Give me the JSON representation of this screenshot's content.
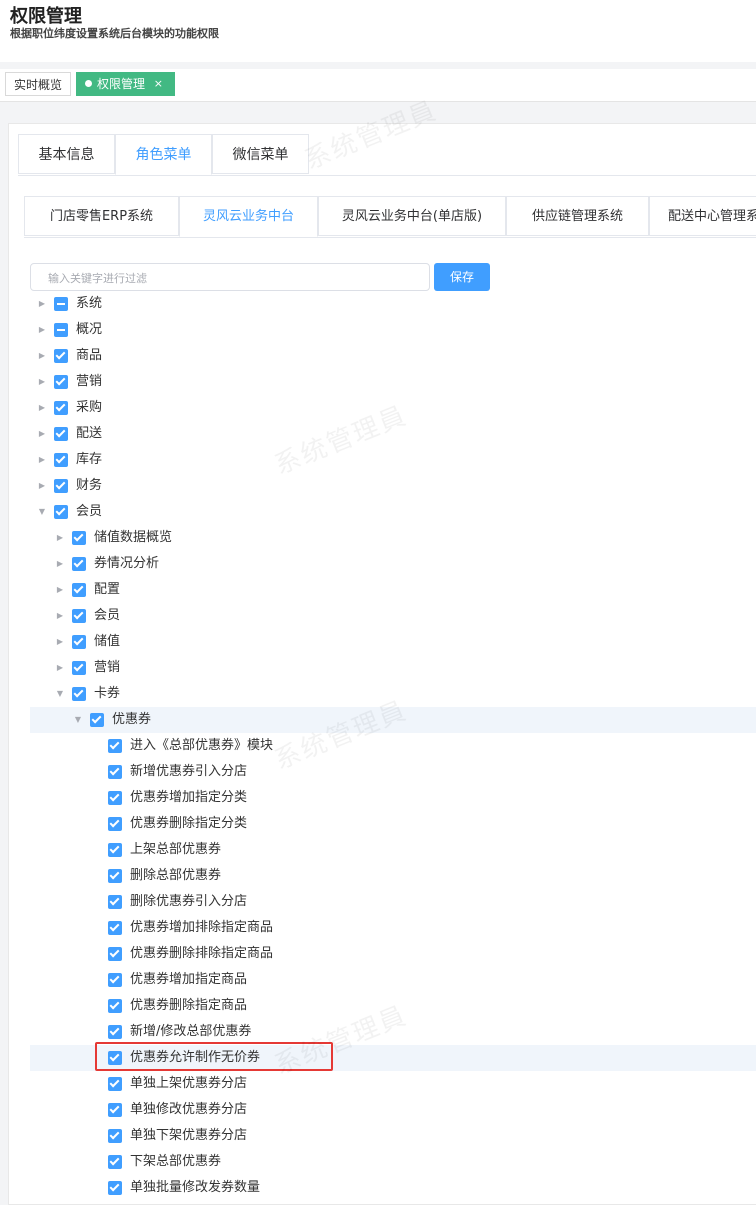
{
  "header": {
    "title": "权限管理",
    "subtitle": "根据职位纬度设置系统后台模块的功能权限"
  },
  "page_tabs": [
    {
      "label": "实时概览"
    },
    {
      "label": "权限管理",
      "close": "×"
    }
  ],
  "tabs_level1": [
    "基本信息",
    "角色菜单",
    "微信菜单"
  ],
  "tabs_level1_active": 1,
  "tabs_level2": [
    "门店零售ERP系统",
    "灵风云业务中台",
    "灵风云业务中台(单店版)",
    "供应链管理系统",
    "配送中心管理系统"
  ],
  "tabs_level2_active": 1,
  "search": {
    "placeholder": "输入关键字进行过滤"
  },
  "save_label": "保存",
  "watermark": "系统管理員",
  "tree": [
    {
      "label": "系统",
      "state": "indeterminate",
      "level": 0,
      "arrow": "right"
    },
    {
      "label": "概况",
      "state": "indeterminate",
      "level": 0,
      "arrow": "right"
    },
    {
      "label": "商品",
      "state": "checked",
      "level": 0,
      "arrow": "right"
    },
    {
      "label": "营销",
      "state": "checked",
      "level": 0,
      "arrow": "right"
    },
    {
      "label": "采购",
      "state": "checked",
      "level": 0,
      "arrow": "right"
    },
    {
      "label": "配送",
      "state": "checked",
      "level": 0,
      "arrow": "right"
    },
    {
      "label": "库存",
      "state": "checked",
      "level": 0,
      "arrow": "right"
    },
    {
      "label": "财务",
      "state": "checked",
      "level": 0,
      "arrow": "right"
    },
    {
      "label": "会员",
      "state": "checked",
      "level": 0,
      "arrow": "down"
    },
    {
      "label": "储值数据概览",
      "state": "checked",
      "level": 1,
      "arrow": "right"
    },
    {
      "label": "券情况分析",
      "state": "checked",
      "level": 1,
      "arrow": "right"
    },
    {
      "label": "配置",
      "state": "checked",
      "level": 1,
      "arrow": "right"
    },
    {
      "label": "会员",
      "state": "checked",
      "level": 1,
      "arrow": "right"
    },
    {
      "label": "储值",
      "state": "checked",
      "level": 1,
      "arrow": "right"
    },
    {
      "label": "营销",
      "state": "checked",
      "level": 1,
      "arrow": "right"
    },
    {
      "label": "卡券",
      "state": "checked",
      "level": 1,
      "arrow": "down"
    },
    {
      "label": "优惠券",
      "state": "checked",
      "level": 2,
      "arrow": "down",
      "highlight": true
    },
    {
      "label": "进入《总部优惠券》模块",
      "state": "checked",
      "level": 3
    },
    {
      "label": "新增优惠券引入分店",
      "state": "checked",
      "level": 3
    },
    {
      "label": "优惠券增加指定分类",
      "state": "checked",
      "level": 3
    },
    {
      "label": "优惠券删除指定分类",
      "state": "checked",
      "level": 3
    },
    {
      "label": "上架总部优惠券",
      "state": "checked",
      "level": 3
    },
    {
      "label": "删除总部优惠券",
      "state": "checked",
      "level": 3
    },
    {
      "label": "删除优惠券引入分店",
      "state": "checked",
      "level": 3
    },
    {
      "label": "优惠券增加排除指定商品",
      "state": "checked",
      "level": 3
    },
    {
      "label": "优惠券删除排除指定商品",
      "state": "checked",
      "level": 3
    },
    {
      "label": "优惠券增加指定商品",
      "state": "checked",
      "level": 3
    },
    {
      "label": "优惠券删除指定商品",
      "state": "checked",
      "level": 3
    },
    {
      "label": "新增/修改总部优惠券",
      "state": "checked",
      "level": 3
    },
    {
      "label": "优惠券允许制作无价券",
      "state": "checked",
      "level": 3,
      "highlight": true,
      "boxed": true
    },
    {
      "label": "单独上架优惠券分店",
      "state": "checked",
      "level": 3
    },
    {
      "label": "单独修改优惠券分店",
      "state": "checked",
      "level": 3
    },
    {
      "label": "单独下架优惠券分店",
      "state": "checked",
      "level": 3
    },
    {
      "label": "下架总部优惠券",
      "state": "checked",
      "level": 3
    },
    {
      "label": "单独批量修改发券数量",
      "state": "checked",
      "level": 3
    }
  ]
}
